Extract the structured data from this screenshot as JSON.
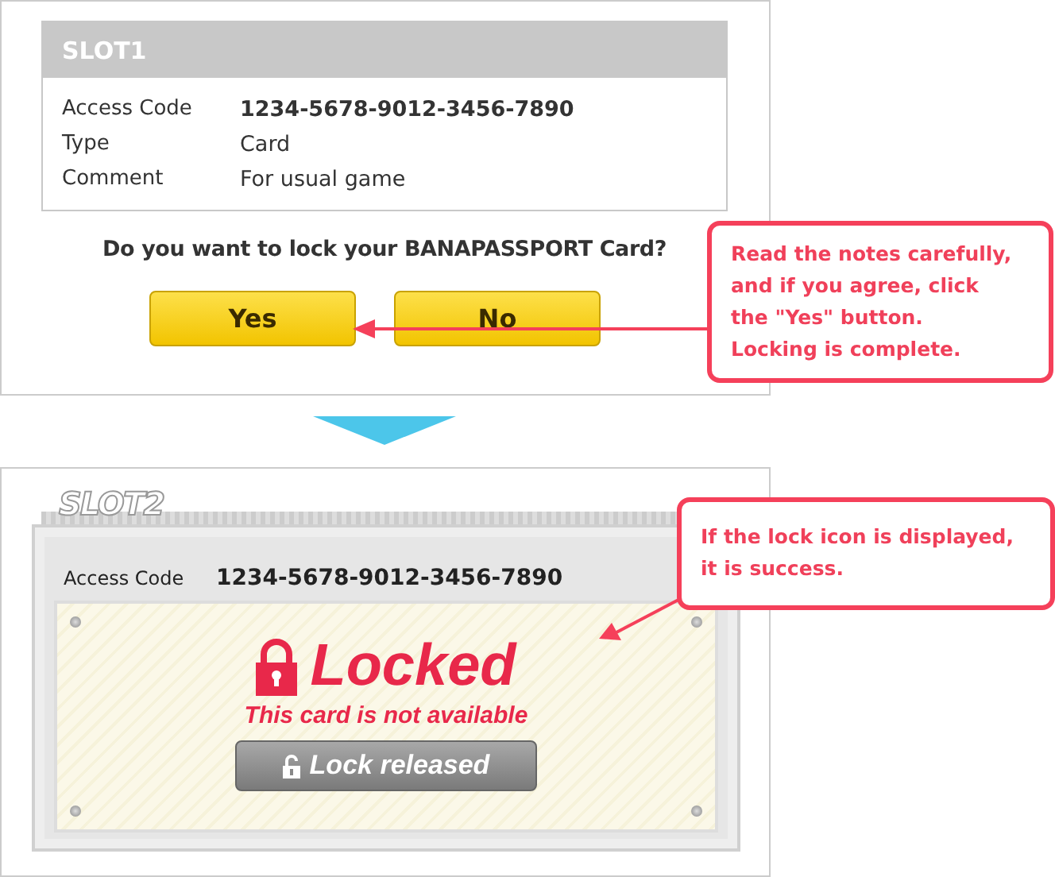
{
  "slot1": {
    "title": "SLOT1",
    "fields": [
      {
        "label": "Access Code",
        "value": "1234-5678-9012-3456-7890"
      },
      {
        "label": "Type",
        "value": "Card"
      },
      {
        "label": "Comment",
        "value": "For usual game"
      }
    ],
    "question": "Do you want to lock your BANAPASSPORT Card?",
    "buttons": [
      "Yes",
      "No"
    ]
  },
  "slot2": {
    "title": "SLOT2",
    "fields": [
      {
        "label": "Access Code",
        "value": "1234-5678-9012-3456-7890"
      }
    ],
    "status": "Locked",
    "message": "This card is not available",
    "release_button": "Lock released"
  },
  "callouts": [
    {
      "lines": [
        "Read the notes carefully,",
        "and if you agree, click",
        "the \"Yes\" button.",
        "Locking is complete."
      ]
    },
    {
      "lines": [
        "If the lock icon is displayed,",
        "it is success."
      ]
    }
  ]
}
